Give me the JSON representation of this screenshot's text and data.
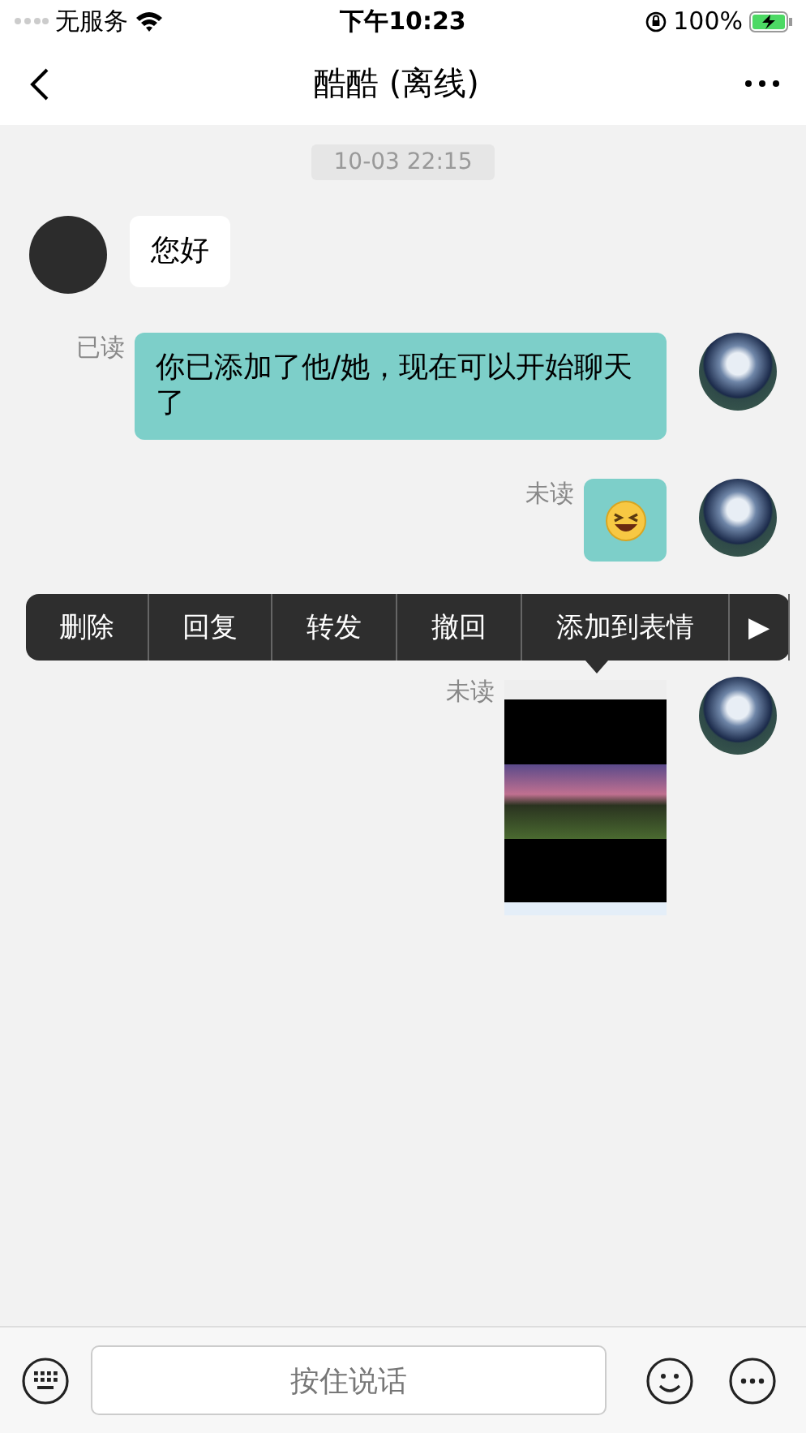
{
  "status_bar": {
    "carrier": "无服务",
    "time": "下午10:23",
    "battery": "100%"
  },
  "nav": {
    "title": "酷酷 (离线)"
  },
  "messages": [
    {
      "kind": "time",
      "text": "10-03 22:15"
    },
    {
      "kind": "text",
      "outgoing": false,
      "text": "您好"
    },
    {
      "kind": "text",
      "outgoing": true,
      "receipt": "已读",
      "text": "你已添加了他/她，现在可以开始聊天了"
    },
    {
      "kind": "emoji",
      "outgoing": true,
      "receipt": "未读"
    },
    {
      "kind": "image",
      "outgoing": true,
      "receipt": "未读"
    }
  ],
  "context_menu": {
    "items": [
      "删除",
      "回复",
      "转发",
      "撤回",
      "添加到表情"
    ],
    "more": "▶"
  },
  "input_bar": {
    "placeholder": "按住说话"
  }
}
